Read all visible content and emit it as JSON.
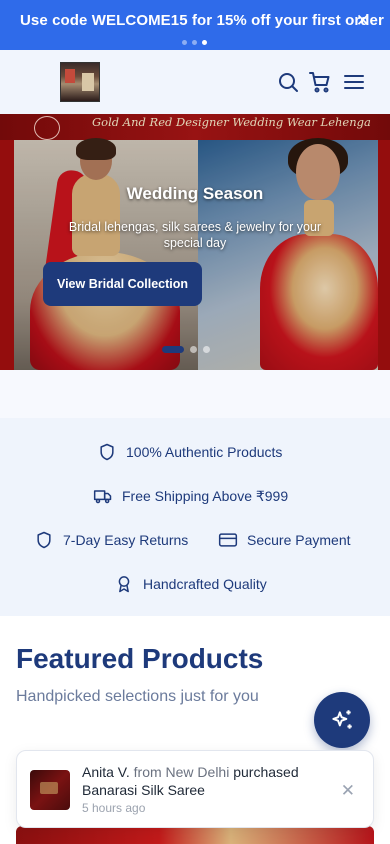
{
  "promo": {
    "text": "Use code WELCOME15 for 15% off your first order",
    "close_icon": "close-icon",
    "slides_count": 3,
    "active_slide": 3
  },
  "header": {
    "logo_icon": "store-logo",
    "icons": [
      "search-icon",
      "cart-icon",
      "menu-icon"
    ]
  },
  "hero": {
    "banner_text": "Gold And Red Designer Wedding Wear Lehenga",
    "title": "Wedding Season",
    "subtitle": "Bridal lehengas, silk sarees & jewelry for your special day",
    "cta_label": "View Bridal Collection",
    "slides_count": 3,
    "active_slide": 1
  },
  "trust": {
    "badges": [
      {
        "icon": "shield-icon",
        "label": "100% Authentic Products"
      },
      {
        "icon": "truck-icon",
        "label": "Free Shipping Above ₹999"
      },
      {
        "icon": "shield-icon",
        "label": "7-Day Easy Returns"
      },
      {
        "icon": "credit-card-icon",
        "label": "Secure Payment"
      },
      {
        "icon": "award-icon",
        "label": "Handcrafted Quality"
      }
    ]
  },
  "featured": {
    "title": "Featured Products",
    "subtitle": "Handpicked selections just for you",
    "fab_icon": "sparkles-icon"
  },
  "toast": {
    "name": "Anita V.",
    "from_text": "from New Delhi",
    "action": "purchased",
    "product": "Banarasi Silk Saree",
    "time": "5 hours ago",
    "close_icon": "close-icon"
  },
  "colors": {
    "promo_bg": "#2f6bea",
    "primary": "#1e3a7b",
    "trust_bg": "#eff4fc",
    "header_bg": "#f1f5fd"
  }
}
